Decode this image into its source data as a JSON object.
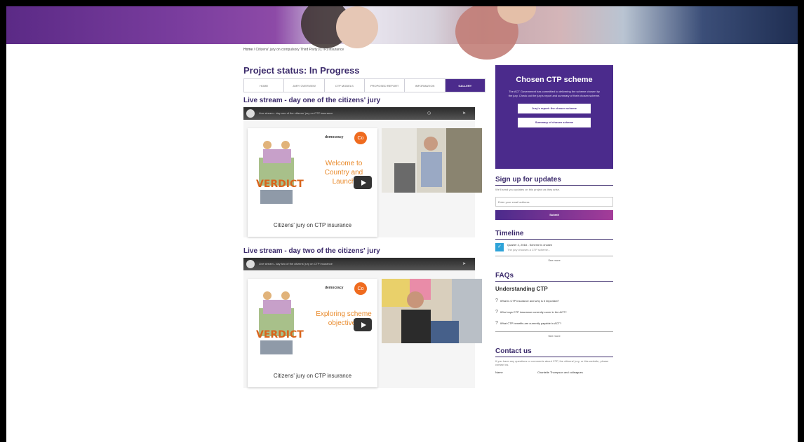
{
  "breadcrumb": {
    "home": "Home",
    "trail": "/ Citizens' jury on compulsory Third Party (CTP) insurance"
  },
  "project_status": "Project status: In Progress",
  "tabs": [
    {
      "label": "HOME",
      "active": false
    },
    {
      "label": "JURY OVERVIEW",
      "active": false
    },
    {
      "label": "CTP MODELS",
      "active": false
    },
    {
      "label": "PROPOSED REPORT",
      "active": false
    },
    {
      "label": "INFORMATION",
      "active": false
    },
    {
      "label": "GALLERY",
      "active": true
    }
  ],
  "streams": [
    {
      "title": "Live stream - day one of the citizens' jury",
      "video_title": "Live stream - day one of the citizens' jury on CTP insurance",
      "logo": "democracy",
      "logo_badge": "Co",
      "welcome": "Welcome to Country and Launch",
      "caption": "Citizens' jury on CTP insurance"
    },
    {
      "title": "Live stream - day two of the citizens' jury",
      "video_title": "Live stream - day two of the citizens' jury on CTP insurance",
      "logo": "democracy",
      "logo_badge": "Co",
      "welcome": "Exploring scheme objectives",
      "caption": "Citizens' jury on CTP insurance"
    }
  ],
  "cta": {
    "title": "Chosen CTP scheme",
    "body": "The ACT Government has committed to delivering the scheme chosen by the jury. Check out the jury's report and summary of their chosen scheme.",
    "btn1": "Jury's report: the chosen scheme",
    "btn2": "Summary of chosen scheme"
  },
  "signup": {
    "title": "Sign up for updates",
    "sub": "We'll send you updates on this project as they arise.",
    "placeholder": "Enter your email address",
    "submit": "Submit"
  },
  "timeline": {
    "title": "Timeline",
    "item_date": "Quarter 2, 2018 - Scheme is chosen",
    "item_body": "The jury chooses a CTP scheme...",
    "see_more": "See more"
  },
  "faqs": {
    "title": "FAQs",
    "subtitle": "Understanding CTP",
    "questions": [
      "What is CTP insurance and why is it important?",
      "Who buys CTP insurance currently cover in the ACT?",
      "What CTP benefits are currently payable in ACT?"
    ],
    "see_more": "See more"
  },
  "contact": {
    "title": "Contact us",
    "body": "If you have any questions or comments about CTP, the citizens' jury, or this website, please contact us.",
    "name_label": "Name",
    "name_value": "Chantelle Thompson and colleagues"
  },
  "colors": {
    "brand_purple": "#4b2b8c",
    "heading": "#3b2a6b",
    "accent_orange": "#ef6b1f",
    "timeline_blue": "#2ea3d8"
  }
}
